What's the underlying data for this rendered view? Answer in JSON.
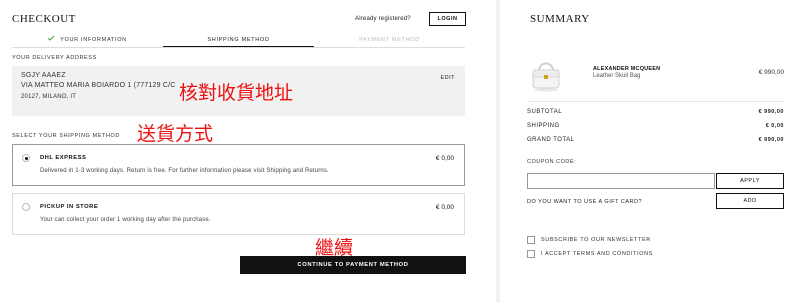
{
  "checkout": {
    "title": "CHECKOUT",
    "already_registered": "Already registered?",
    "login_label": "LOGIN",
    "steps": [
      {
        "label": "YOUR INFORMATION",
        "state": "done"
      },
      {
        "label": "SHIPPING METHOD",
        "state": "active"
      },
      {
        "label": "PAYMENT METHOD",
        "state": "pending"
      }
    ],
    "delivery_label": "YOUR DELIVERY ADDRESS",
    "address": {
      "name": "SGJY AAAEZ",
      "street": "VIA MATTEO MARIA BOIARDO 1 (777129 C/C",
      "city": "20127, MILANO, IT",
      "edit_label": "EDIT"
    },
    "shipping_label": "SELECT YOUR SHIPPING METHOD",
    "options": [
      {
        "name": "DHL EXPRESS",
        "desc": "Delivered in 1-3 working days. Return is free. For further information please visit Shipping and Returns.",
        "price": "€ 0,00",
        "selected": true
      },
      {
        "name": "PICKUP IN STORE",
        "desc": "Your can collect your order 1 working day after the purchase.",
        "price": "€ 0,00",
        "selected": false
      }
    ],
    "continue_label": "CONTINUE TO PAYMENT METHOD"
  },
  "annotations": {
    "verify_address": "核對收貨地址",
    "shipping_method": "送貨方式",
    "continue": "繼續",
    "color": "#ee1111"
  },
  "summary": {
    "title": "SUMMARY",
    "item": {
      "brand": "ALEXANDER MCQUEEN",
      "name": "Leather Skull Bag",
      "price": "€ 990,00",
      "icon": "white-handbag"
    },
    "subtotal_label": "SUBTOTAL",
    "subtotal": "€ 990,00",
    "shipping_label": "SHIPPING",
    "shipping": "€ 0,00",
    "grand_total_label": "GRAND TOTAL",
    "grand_total": "€ 990,00",
    "coupon_label": "COUPON CODE:",
    "coupon_value": "",
    "apply_label": "APPLY",
    "gift_label": "DO YOU WANT TO USE A GIFT CARD?",
    "add_label": "ADD",
    "newsletter_label": "SUBSCRIBE TO OUR NEWSLETTER",
    "terms_label": "I ACCEPT TERMS AND CONDITIONS"
  }
}
